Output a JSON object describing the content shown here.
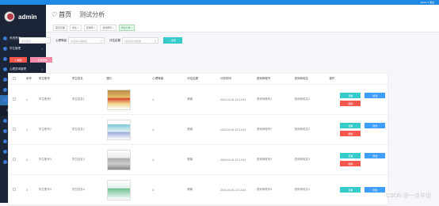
{
  "topbar": {
    "right": "admin ▾ 退出"
  },
  "sidebar": {
    "brand": "admin",
    "items": [
      {
        "label": "系统首页",
        "icon": "home-icon"
      },
      {
        "label": "学生管理",
        "icon": "user-icon"
      },
      {
        "label": "咨询师管理",
        "icon": "user-icon"
      },
      {
        "label": "心理咨询管理",
        "icon": "chat-icon"
      },
      {
        "label": "咨询预约管理",
        "icon": "calendar-icon"
      },
      {
        "label": "咨询记录管理",
        "icon": "list-icon"
      },
      {
        "label": "测试分析管理",
        "icon": "chart-icon",
        "active": true
      },
      {
        "label": "心理测试管理",
        "icon": "doc-icon",
        "sub": true
      },
      {
        "label": "试题管理",
        "icon": "book-icon"
      },
      {
        "label": "系统管理",
        "icon": "gear-icon"
      },
      {
        "label": "心理健康管理",
        "icon": "heart-icon"
      },
      {
        "label": "心理资讯管理",
        "icon": "news-icon"
      },
      {
        "label": "我的信息",
        "icon": "user-icon"
      }
    ]
  },
  "header": {
    "home": "首页",
    "page": "测试分析"
  },
  "tabs": [
    "首页页面",
    "学生 ×",
    "咨询师 ×",
    "咨询预约 ×",
    "测试分析 ×"
  ],
  "search": {
    "l1": "学生姓名",
    "p1": "学生姓名",
    "l2": "心理等级",
    "p2": "请选择心理等级",
    "l3": "评估结果",
    "p3": "请选择评估结果",
    "btn": "搜索"
  },
  "actions": {
    "del": "删除",
    "pink": "分析报告"
  },
  "table": {
    "headers": [
      "",
      "序号",
      "学生账号",
      "学生姓名",
      "图片",
      "心理等级",
      "评估结果",
      "分析时间",
      "咨询师账号",
      "咨询师姓名",
      "操作"
    ],
    "rows": [
      {
        "no": "1",
        "acc": "学生账号1",
        "name": "学生姓名1",
        "level": "4",
        "result": "健康",
        "time": "2024-04-01 22:13:41",
        "cacc": "咨询师账号1",
        "cname": "咨询师姓名1"
      },
      {
        "no": "2",
        "acc": "学生账号2",
        "name": "学生姓名2",
        "level": "4",
        "result": "健康",
        "time": "2024-04-01 22:13:41",
        "cacc": "咨询师账号2",
        "cname": "咨询师姓名2"
      },
      {
        "no": "3",
        "acc": "学生账号3",
        "name": "学生姓名3",
        "level": "4",
        "result": "健康",
        "time": "2024-04-01 22:13:41",
        "cacc": "咨询师账号3",
        "cname": "咨询师姓名3"
      },
      {
        "no": "4",
        "acc": "学生账号4",
        "name": "学生姓名4",
        "level": "4",
        "result": "健康",
        "time": "2024-04-01 22:13:41",
        "cacc": "咨询师账号4",
        "cname": "咨询师姓名4"
      }
    ],
    "ops": {
      "view": "查看",
      "edit": "修改",
      "del": "删除"
    }
  },
  "watermark": "CSDN @一点毕设"
}
